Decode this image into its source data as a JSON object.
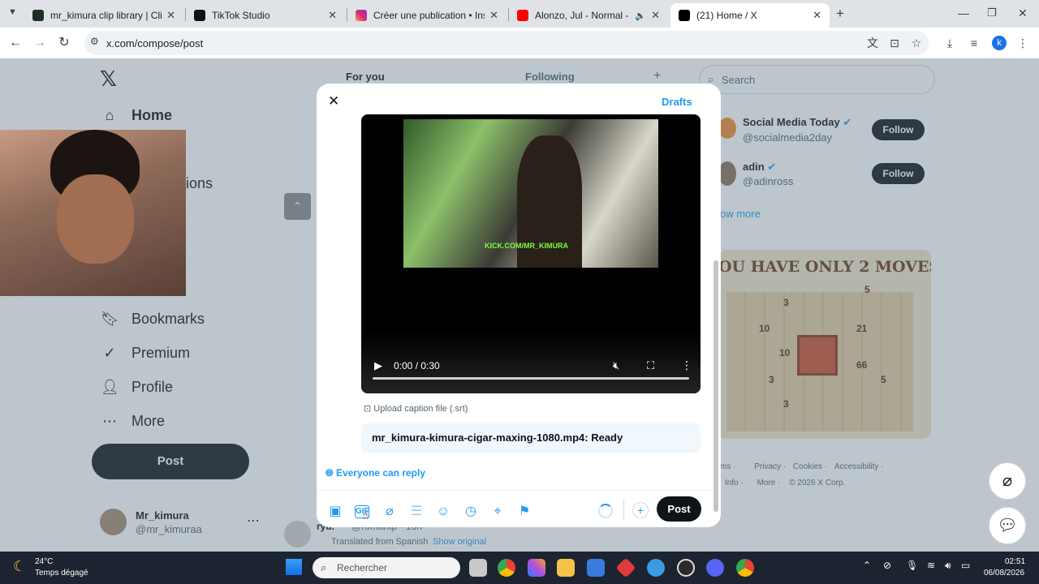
{
  "tabs": [
    {
      "title": "mr_kimura clip library | ClipLabz",
      "active": false
    },
    {
      "title": "TikTok Studio",
      "active": false
    },
    {
      "title": "Créer une publication • Instagram",
      "active": false
    },
    {
      "title": "Alonzo, Jul - Normal - YouTube",
      "active": false
    },
    {
      "title": "(21) Home / X",
      "active": true
    }
  ],
  "browser": {
    "url": "x.com/compose/post",
    "profile_initial": "k"
  },
  "x": {
    "feed_tabs": [
      "For you",
      "Following"
    ],
    "nav": {
      "home": "Home",
      "notifications_partial": "ions",
      "bookmarks": "Bookmarks",
      "premium": "Premium",
      "profile": "Profile",
      "more": "More"
    },
    "post_label": "Post",
    "account": {
      "name": "Mr_kimura",
      "handle": "@mr_kimuraa"
    },
    "search_placeholder": "Search",
    "who_to_follow": [
      {
        "name": "Social Media Today",
        "handle": "@socialmedia2day",
        "verified": true
      },
      {
        "name": "adin",
        "handle": "@adinross",
        "verified": true
      }
    ],
    "follow_label": "Follow",
    "show_more": "ow more",
    "ad_text": "OU HAVE ONLY 2 MOVES",
    "ad_numbers": [
      "5",
      "3",
      "10",
      "21",
      "10",
      "66",
      "3",
      "5",
      "3"
    ],
    "footer": {
      "line1": [
        "ms",
        "Privacy",
        "Cookies",
        "Accessibility"
      ],
      "line2": [
        "Info",
        "More",
        "© 2026 X Corp."
      ]
    },
    "feed_bottom": {
      "name": "ryu.",
      "handle": "@romantp · 16h",
      "translated": "Translated from Spanish",
      "show_original": "Show original"
    }
  },
  "modal": {
    "drafts": "Drafts",
    "video_overlay_text": "KICK.COM/MR_KIMURA",
    "video_time": "0:00 / 0:30",
    "upload_caption": "Upload caption file (.srt)",
    "file_status": "mr_kimura-kimura-cigar-maxing-1080.mp4: Ready",
    "reply_setting": "Everyone can reply",
    "post_button": "Post",
    "toolbar_icons": [
      "media-icon",
      "gif-icon",
      "grok-icon",
      "poll-icon",
      "emoji-icon",
      "schedule-icon",
      "location-icon",
      "flag-icon"
    ]
  },
  "taskbar": {
    "weather_temp": "24°C",
    "weather_desc": "Temps dégagé",
    "search_placeholder": "Rechercher",
    "time": "02:51",
    "date": "06/08/2026"
  },
  "colors": {
    "x_blue": "#1d9bf0",
    "dark": "#0f1419",
    "chrome_tabbar": "#dfe3e8",
    "taskbar": "#1b2430"
  }
}
